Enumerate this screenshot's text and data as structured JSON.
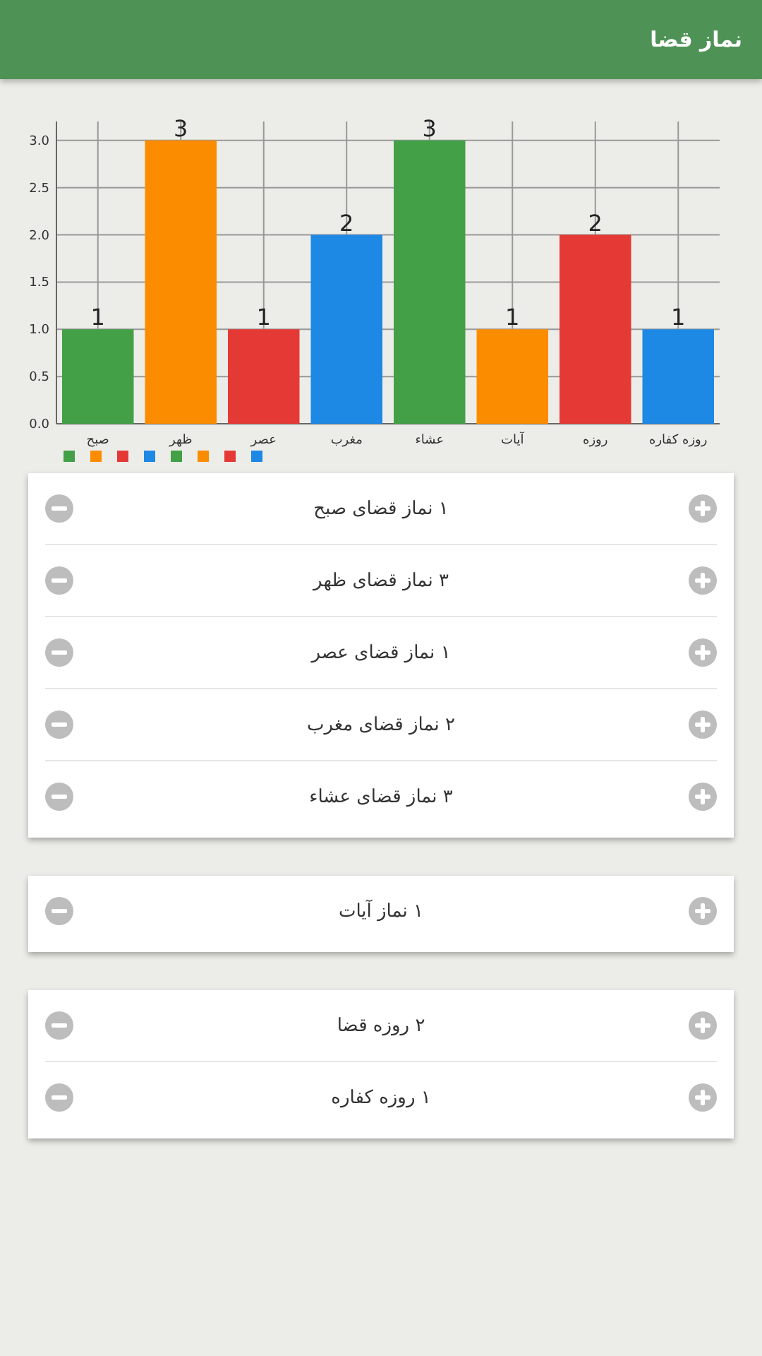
{
  "app_bar": {
    "title": "نماز قضا"
  },
  "chart": {
    "chart_data": {
      "type": "bar",
      "categories": [
        "صبح",
        "ظهر",
        "عصر",
        "مغرب",
        "عشاء",
        "آیات",
        "روزه",
        "روزه کفاره"
      ],
      "series": [
        {
          "values": [
            1,
            3,
            1,
            2,
            3,
            1,
            2,
            1
          ]
        }
      ],
      "grid": true,
      "colors": [
        "#43a047",
        "#fb8c00",
        "#e53935",
        "#1e88e5",
        "#43a047",
        "#fb8c00",
        "#e53935",
        "#1e88e5"
      ],
      "ylim": [
        0,
        3.2
      ],
      "yticks": [
        {
          "value": 0,
          "label": "0.0"
        },
        {
          "value": 0.5,
          "label": "0.5"
        },
        {
          "value": 1,
          "label": "1.0"
        },
        {
          "value": 1.5,
          "label": "1.5"
        },
        {
          "value": 2,
          "label": "2.0"
        },
        {
          "value": 2.5,
          "label": "2.5"
        },
        {
          "value": 3,
          "label": "3.0"
        }
      ],
      "data_labels": true
    }
  },
  "cards": [
    {
      "items": [
        {
          "label": "۱ نماز قضای صبح"
        },
        {
          "label": "۳ نماز قضای ظهر"
        },
        {
          "label": "۱ نماز قضای عصر"
        },
        {
          "label": "۲ نماز قضای مغرب"
        },
        {
          "label": "۳ نماز قضای عشاء"
        }
      ]
    },
    {
      "items": [
        {
          "label": "۱ نماز آیات"
        }
      ]
    },
    {
      "items": [
        {
          "label": "۲ روزه قضا"
        },
        {
          "label": "۱ روزه کفاره"
        }
      ]
    }
  ]
}
